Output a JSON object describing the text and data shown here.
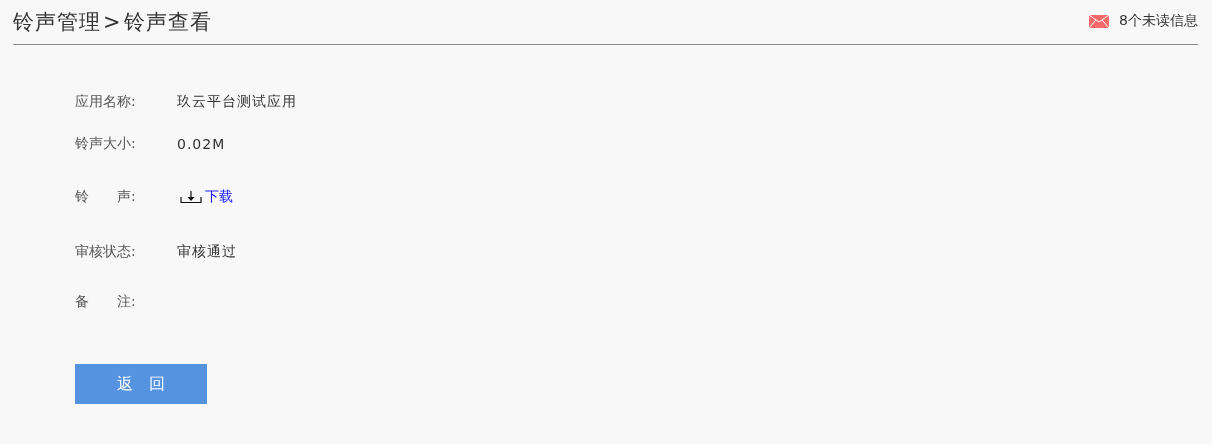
{
  "breadcrumb": {
    "parent": "铃声管理",
    "separator": ">",
    "current": "铃声查看"
  },
  "notice": {
    "text": "8个未读信息"
  },
  "fields": [
    {
      "label": "应用名称:",
      "kind": "text",
      "value": "玖云平台测试应用"
    },
    {
      "label": "铃声大小:",
      "kind": "text",
      "value": "0.02M"
    },
    {
      "label": "铃　　声:",
      "kind": "download",
      "value": "下载"
    },
    {
      "label": "审核状态:",
      "kind": "text",
      "value": "审核通过"
    },
    {
      "label": "备　　注:",
      "kind": "empty"
    }
  ],
  "buttons": [
    "返　回"
  ]
}
